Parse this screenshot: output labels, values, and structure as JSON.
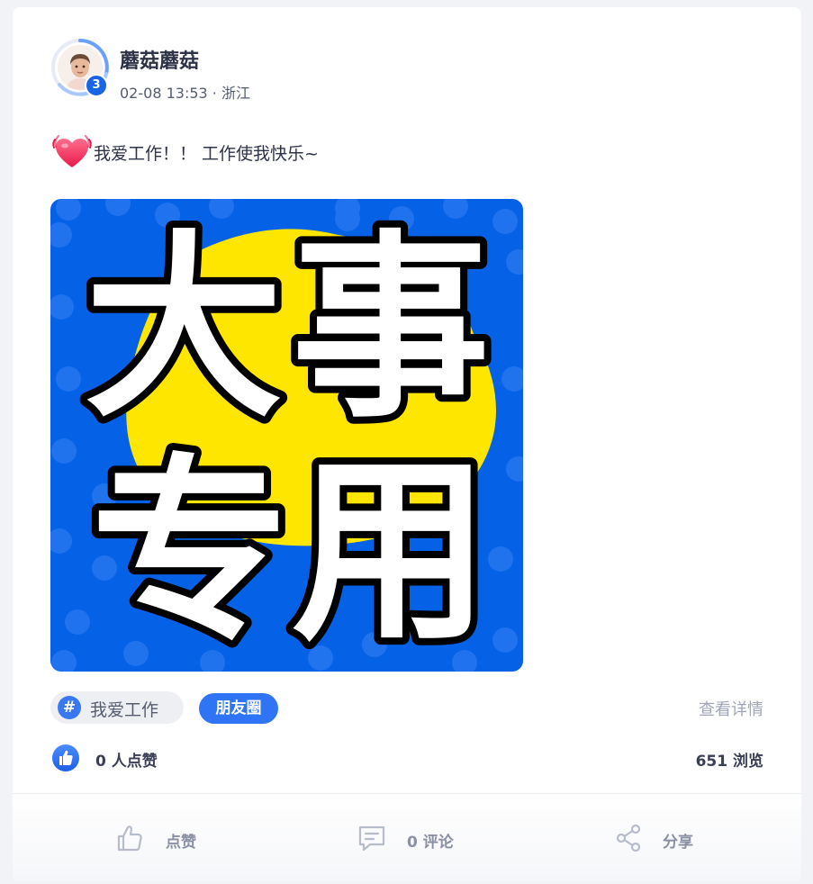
{
  "post": {
    "author": {
      "name": "蘑菇蘑菇",
      "level": "3",
      "meta": "02-08 13:53 · 浙江"
    },
    "content": {
      "emoji": "heart-with-signal-icon",
      "text": "我爱工作！！  工作使我快乐~"
    },
    "image": {
      "text": [
        "大",
        "事",
        "专",
        "用"
      ],
      "colors": {
        "background": "#0561e6",
        "blob": "#ffe600",
        "text": "#ffffff",
        "outline": "#000000"
      }
    },
    "tags": {
      "topic": "我爱工作",
      "circle": "朋友圈",
      "view_detail": "查看详情"
    },
    "stats": {
      "likes": "0 人点赞",
      "views": "651 浏览"
    },
    "actions": {
      "like": "点赞",
      "comment": "0 评论",
      "share": "分享"
    }
  },
  "colors": {
    "accent": "#2f74f5",
    "badge": "#1a64e6",
    "muted": "#a0a6b8"
  }
}
